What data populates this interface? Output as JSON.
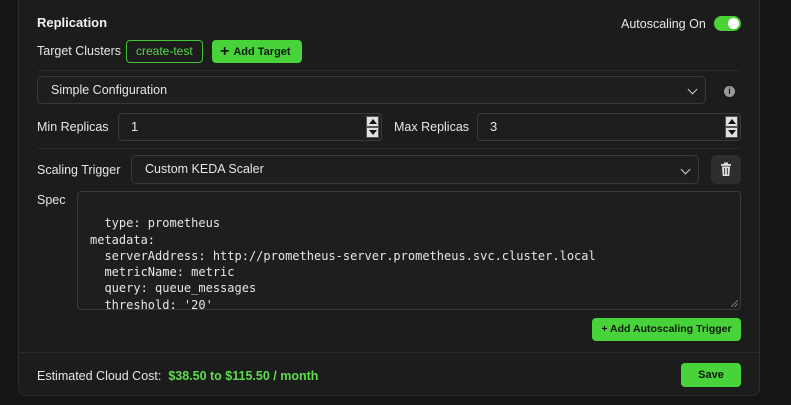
{
  "replication": {
    "title": "Replication",
    "autoscaling_label": "Autoscaling On",
    "autoscaling_on": true,
    "target_clusters_label": "Target Clusters",
    "cluster_chip": "create-test",
    "add_target_label": "Add Target",
    "config_select": "Simple Configuration",
    "min_replicas_label": "Min Replicas",
    "min_replicas_value": "1",
    "max_replicas_label": "Max Replicas",
    "max_replicas_value": "3",
    "scaling_trigger_label": "Scaling Trigger",
    "scaling_trigger_value": "Custom KEDA Scaler",
    "spec_label": "Spec",
    "spec_text": "type: prometheus\nmetadata:\n  serverAddress: http://prometheus-server.prometheus.svc.cluster.local\n  metricName: metric\n  query: queue_messages\n  threshold: '20'",
    "add_trigger_label": "+ Add Autoscaling Trigger"
  },
  "footer": {
    "cost_label": "Estimated Cloud Cost:",
    "cost_value": "$38.50 to $115.50 / month",
    "save_label": "Save"
  },
  "colors": {
    "accent": "#48d33a",
    "background": "#1c1c1c"
  },
  "icons": [
    "plus-icon",
    "chevron-down-icon",
    "info-icon",
    "trash-icon",
    "resize-handle-icon"
  ]
}
